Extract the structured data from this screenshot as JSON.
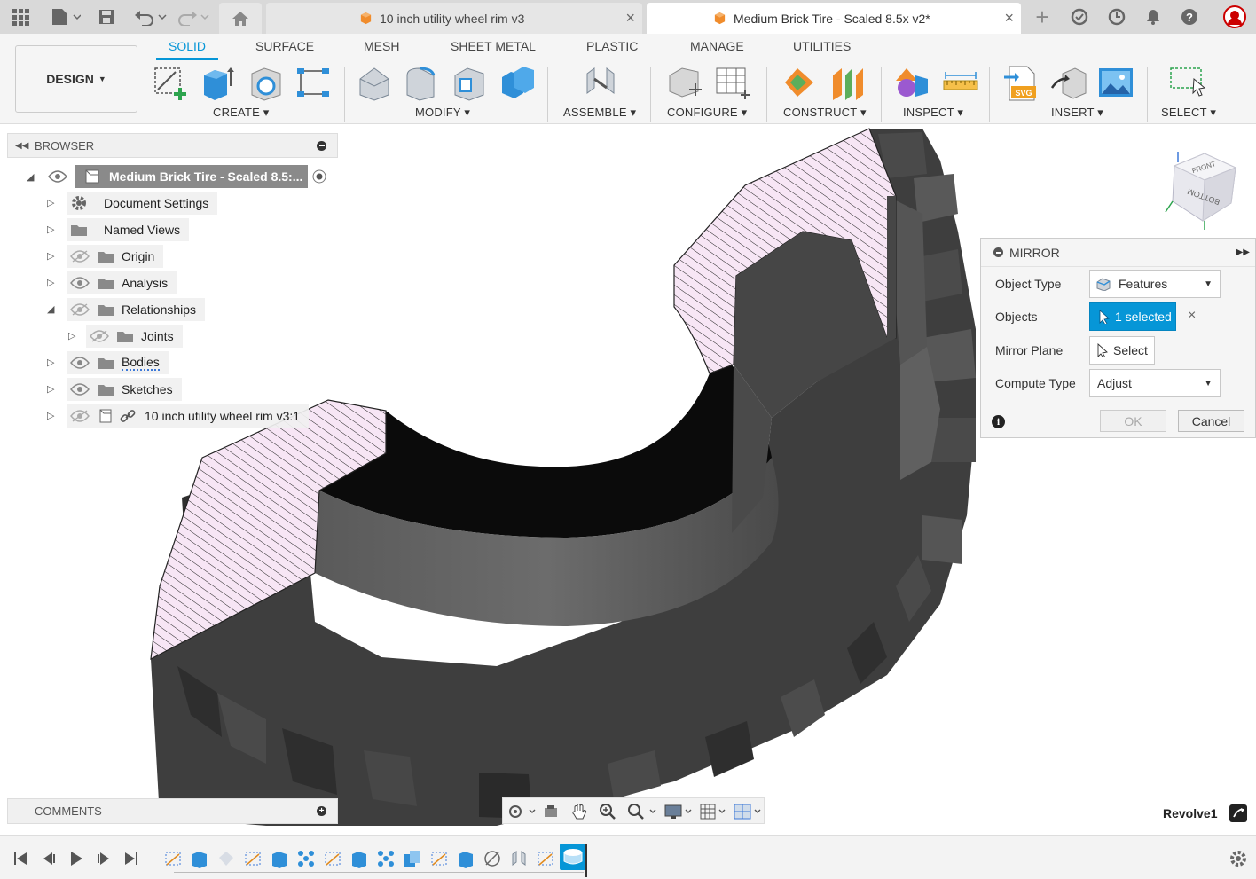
{
  "app": {
    "tabs": [
      {
        "label": "10 inch utility wheel rim v3",
        "active": false
      },
      {
        "label": "Medium Brick Tire - Scaled 8.5x v2*",
        "active": true
      }
    ]
  },
  "ribbon": {
    "workspace": "DESIGN",
    "tabs": [
      "SOLID",
      "SURFACE",
      "MESH",
      "SHEET METAL",
      "PLASTIC",
      "MANAGE",
      "UTILITIES"
    ],
    "active_tab": "SOLID",
    "groups": [
      "CREATE",
      "MODIFY",
      "ASSEMBLE",
      "CONFIGURE",
      "CONSTRUCT",
      "INSPECT",
      "INSERT",
      "SELECT"
    ]
  },
  "browser": {
    "title": "BROWSER",
    "root": "Medium Brick Tire - Scaled 8.5:...",
    "items": [
      {
        "label": "Document Settings",
        "icon": "gear-icon",
        "visibility": "none"
      },
      {
        "label": "Named Views",
        "icon": "folder-icon",
        "visibility": "none"
      },
      {
        "label": "Origin",
        "icon": "folder-icon",
        "visibility": "hidden"
      },
      {
        "label": "Analysis",
        "icon": "folder-icon",
        "visibility": "visible"
      },
      {
        "label": "Relationships",
        "icon": "folder-icon",
        "visibility": "hidden",
        "expanded": true
      },
      {
        "label": "Joints",
        "icon": "folder-icon",
        "visibility": "hidden",
        "indent": 1
      },
      {
        "label": "Bodies",
        "icon": "folder-icon",
        "visibility": "visible"
      },
      {
        "label": "Sketches",
        "icon": "folder-icon",
        "visibility": "visible"
      },
      {
        "label": "10 inch utility wheel rim v3:1",
        "icon": "component-link-icon",
        "visibility": "hidden"
      }
    ]
  },
  "mirror": {
    "title": "MIRROR",
    "object_type_label": "Object Type",
    "object_type_value": "Features",
    "objects_label": "Objects",
    "objects_value": "1 selected",
    "mirror_plane_label": "Mirror Plane",
    "mirror_plane_value": "Select",
    "compute_type_label": "Compute Type",
    "compute_type_value": "Adjust",
    "ok": "OK",
    "cancel": "Cancel"
  },
  "comments": {
    "title": "COMMENTS"
  },
  "status": {
    "active_feature": "Revolve1"
  },
  "viewcube": {
    "labels": [
      "FRONT",
      "BOTTOM"
    ]
  },
  "colors": {
    "accent": "#0696d7",
    "tire": "#3c3c3c",
    "section_hatch": "#f7e6f5"
  }
}
